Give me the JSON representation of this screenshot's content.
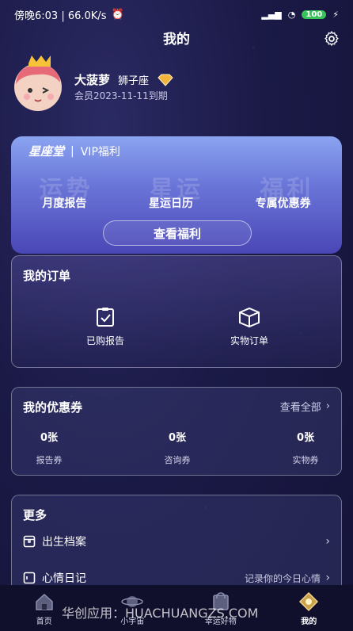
{
  "status_bar": {
    "time_speed": "傍晚6:03 | 66.0K/s",
    "battery": "100"
  },
  "header": {
    "title": "我的"
  },
  "profile": {
    "name": "大菠萝",
    "zodiac": "狮子座",
    "membership": "会员2023-11-11到期"
  },
  "vip": {
    "brand": "星座堂",
    "title": "VIP福利",
    "ghost_texts": [
      "运势",
      "星运",
      "福利"
    ],
    "features": [
      "月度报告",
      "星运日历",
      "专属优惠券"
    ],
    "button": "查看福利"
  },
  "orders": {
    "title": "我的订单",
    "items": [
      "已购报告",
      "实物订单"
    ]
  },
  "coupons": {
    "title": "我的优惠券",
    "view_all": "查看全部",
    "items": [
      {
        "count": "0张",
        "label": "报告券"
      },
      {
        "count": "0张",
        "label": "咨询券"
      },
      {
        "count": "0张",
        "label": "实物券"
      }
    ]
  },
  "more": {
    "title": "更多",
    "items": [
      {
        "label": "出生档案",
        "hint": ""
      },
      {
        "label": "心情日记",
        "hint": "记录你的今日心情"
      }
    ]
  },
  "tabs": [
    {
      "label": "首页",
      "icon": "home-icon"
    },
    {
      "label": "小宇宙",
      "icon": "planet-icon"
    },
    {
      "label": "幸运好物",
      "icon": "shop-icon"
    },
    {
      "label": "我的",
      "icon": "profile-icon"
    }
  ],
  "watermark": "华创应用：HUACHUANGZS.COM",
  "colors": {
    "background": "#1b1a47",
    "vip_top": "#8aa4f0",
    "vip_bottom": "#4a46b6",
    "battery": "#37c35a"
  }
}
